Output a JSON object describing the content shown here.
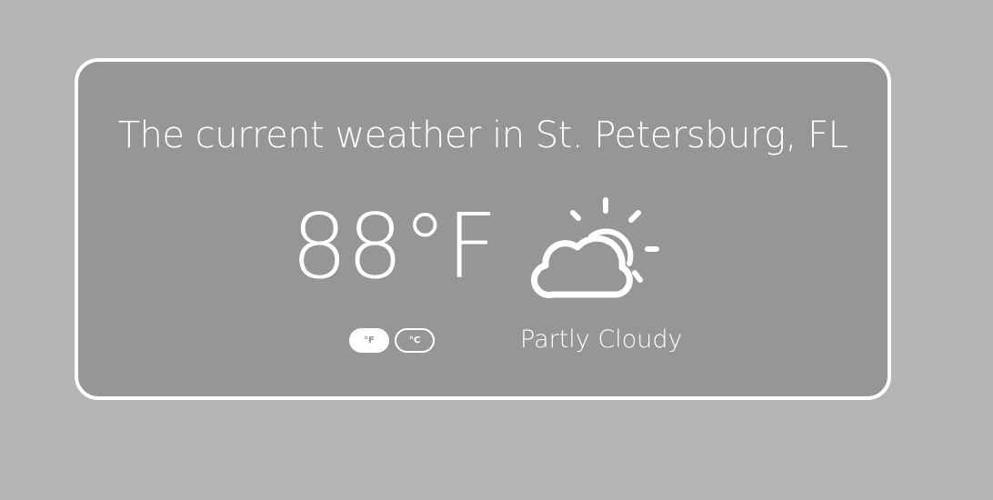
{
  "widget": {
    "title": "The current weather in St. Petersburg, FL",
    "temperature": "88°F",
    "condition": "Partly Cloudy",
    "condition_icon": "partly-cloudy-icon",
    "units": {
      "fahrenheit_label": "°F",
      "celsius_label": "°C",
      "selected": "fahrenheit"
    }
  },
  "colors": {
    "page_background": "#b4b4b4",
    "card_background": "#969696",
    "foreground": "#ffffff"
  }
}
